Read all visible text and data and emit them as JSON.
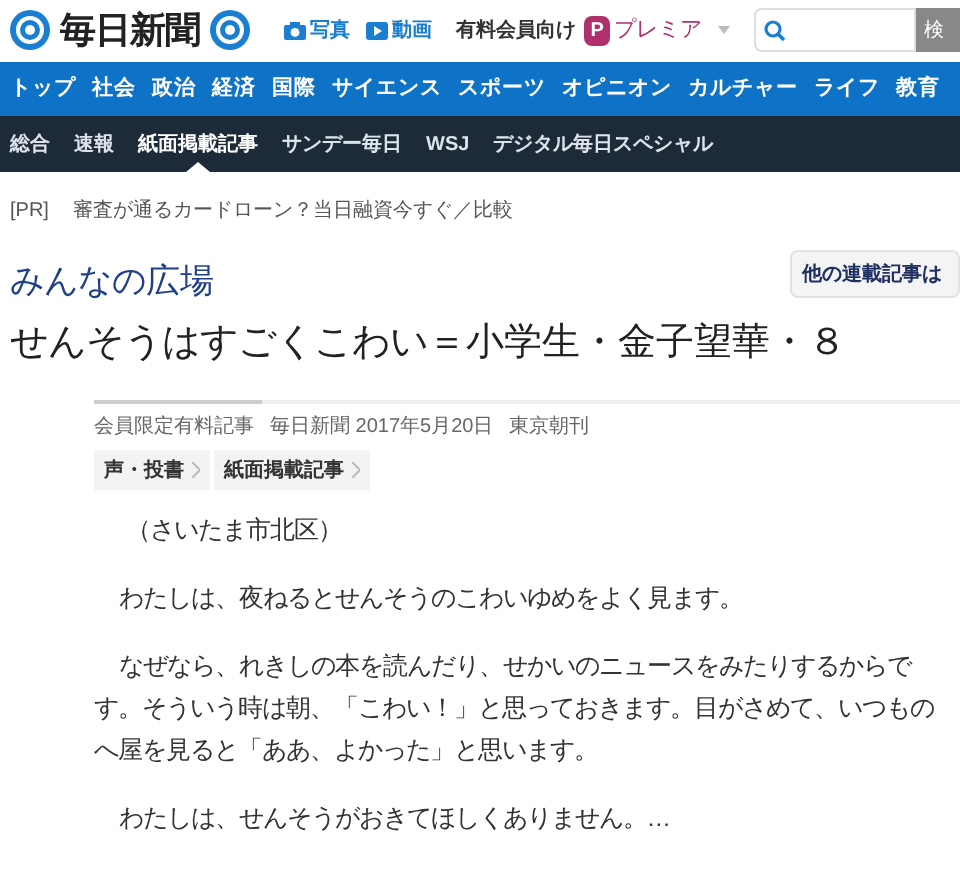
{
  "header": {
    "logo": "毎日新聞",
    "links": [
      {
        "label": "写真",
        "kind": "camera"
      },
      {
        "label": "動画",
        "kind": "play"
      }
    ],
    "member_label": "有料会員向け",
    "premier": {
      "badge": "P",
      "label": "プレミア"
    },
    "search": {
      "button": "検"
    }
  },
  "main_nav": [
    {
      "label": "トップ",
      "selected": false
    },
    {
      "label": "社会",
      "selected": false
    },
    {
      "label": "政治",
      "selected": false
    },
    {
      "label": "経済",
      "selected": false
    },
    {
      "label": "国際",
      "selected": false
    },
    {
      "label": "サイエンス",
      "selected": false
    },
    {
      "label": "スポーツ",
      "selected": false
    },
    {
      "label": "オピニオン",
      "selected": false
    },
    {
      "label": "カルチャー",
      "selected": false
    },
    {
      "label": "ライフ",
      "selected": false
    },
    {
      "label": "教育",
      "selected": false
    }
  ],
  "sub_nav": [
    {
      "label": "総合",
      "selected": false
    },
    {
      "label": "速報",
      "selected": false
    },
    {
      "label": "紙面掲載記事",
      "selected": true
    },
    {
      "label": "サンデー毎日",
      "selected": false
    },
    {
      "label": "WSJ",
      "selected": false
    },
    {
      "label": "デジタル毎日スペシャル",
      "selected": false
    }
  ],
  "ad": {
    "tag": "[PR]",
    "text": "審査が通るカードローン？当日融資今すぐ／比較"
  },
  "article": {
    "section": "みんなの広場",
    "other_series_button": "他の連載記事は",
    "headline": "せんそうはすごくこわい＝小学生・金子望華・８",
    "meta": [
      "会員限定有料記事",
      "毎日新聞 2017年5月20日",
      "東京朝刊"
    ],
    "breadcrumbs": [
      "声・投書",
      "紙面掲載記事"
    ],
    "paragraphs": [
      "（さいたま市北区）",
      "わたしは、夜ねるとせんそうのこわいゆめをよく見ます。",
      "なぜなら、れきしの本を読んだり、せかいのニュースをみたりするからです。そういう時は朝、「こわい！」と思っておきます。目がさめて、いつものへ屋を見ると「ああ、よかった」と思います。",
      "わたしは、せんそうがおきてほしくありません。…"
    ]
  }
}
